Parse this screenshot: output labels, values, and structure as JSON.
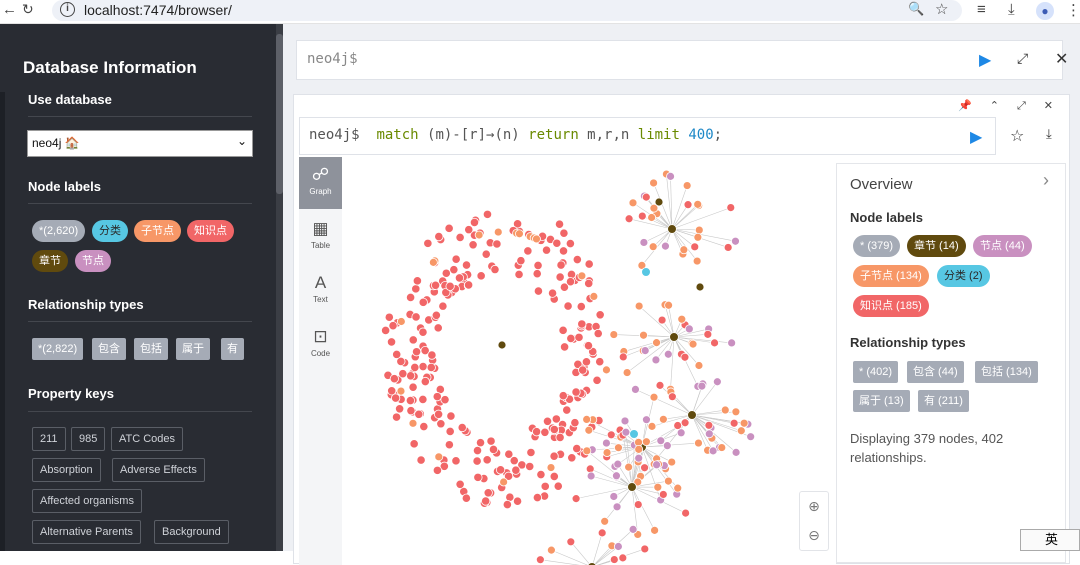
{
  "browser": {
    "url": "localhost:7474/browser/"
  },
  "sidebar": {
    "title": "Database Information",
    "use_database_label": "Use database",
    "database": "neo4j 🏠",
    "node_labels_title": "Node labels",
    "node_labels": [
      {
        "label": "*(2,620)",
        "bg": "#a5abb6",
        "fg": "#ffffff"
      },
      {
        "label": "分类",
        "bg": "#57c7e3",
        "fg": "#2a2a2a"
      },
      {
        "label": "子节点",
        "bg": "#f79767",
        "fg": "#ffffff"
      },
      {
        "label": "知识点",
        "bg": "#f16667",
        "fg": "#ffffff"
      },
      {
        "label": "章节",
        "bg": "#604a0e",
        "fg": "#ffffff"
      },
      {
        "label": "节点",
        "bg": "#c990c0",
        "fg": "#ffffff"
      }
    ],
    "relationship_types_title": "Relationship types",
    "relationship_types": [
      "*(2,822)",
      "包含",
      "包括",
      "属于",
      "有"
    ],
    "property_keys_title": "Property keys",
    "property_keys": [
      "211",
      "985",
      "ATC Codes",
      "Absorption",
      "Adverse Effects",
      "Affected organisms",
      "Alternative Parents",
      "Background"
    ]
  },
  "editor": {
    "prompt": "neo4j$"
  },
  "frame": {
    "query": {
      "prompt": "neo4j$",
      "k1": "match",
      "p1": " (m)-[r]→(n) ",
      "k2": "return",
      "p2": " m,r,n ",
      "k3": "limit",
      "num": "400",
      "end": ";"
    },
    "tabs": [
      {
        "label": "Graph",
        "icon": "graph-icon"
      },
      {
        "label": "Table",
        "icon": "table-icon"
      },
      {
        "label": "Text",
        "icon": "text-icon"
      },
      {
        "label": "Code",
        "icon": "code-icon"
      }
    ]
  },
  "overview": {
    "title": "Overview",
    "node_labels_title": "Node labels",
    "node_labels": [
      {
        "label": "* (379)",
        "bg": "#a5abb6",
        "fg": "#ffffff"
      },
      {
        "label": "章节 (14)",
        "bg": "#604a0e",
        "fg": "#ffffff"
      },
      {
        "label": "节点 (44)",
        "bg": "#c990c0",
        "fg": "#ffffff"
      },
      {
        "label": "子节点 (134)",
        "bg": "#f79767",
        "fg": "#ffffff"
      },
      {
        "label": "分类 (2)",
        "bg": "#57c7e3",
        "fg": "#2a2a2a"
      },
      {
        "label": "知识点 (185)",
        "bg": "#f16667",
        "fg": "#ffffff"
      }
    ],
    "relationship_types_title": "Relationship types",
    "relationship_types": [
      "* (402)",
      "包含 (44)",
      "包括 (134)",
      "属于 (13)",
      "有 (211)"
    ],
    "description": "Displaying 379 nodes, 402 relationships."
  },
  "graph_colors": {
    "knowledge": "#f16667",
    "child": "#f79767",
    "node": "#c990c0",
    "chapter": "#604a0e",
    "category": "#57c7e3"
  },
  "ime": {
    "label": "英"
  }
}
